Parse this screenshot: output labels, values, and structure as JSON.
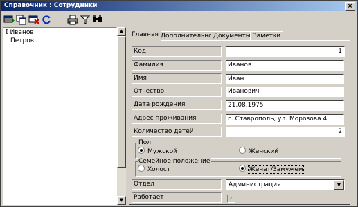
{
  "window": {
    "title": "Справочник : Сотрудники",
    "close_glyph": "×"
  },
  "toolbar": {
    "icons": [
      "add-record-icon",
      "copy-record-icon",
      "delete-record-icon",
      "refresh-icon",
      "print-icon",
      "filter-icon",
      "find-icon"
    ]
  },
  "list": {
    "items": [
      {
        "label": "Иванов",
        "selected": true
      },
      {
        "label": "Петров",
        "selected": false
      }
    ],
    "scroll_up": "▲",
    "scroll_down": "▼"
  },
  "tabs": [
    {
      "label": "Главная",
      "active": true
    },
    {
      "label": "Дополнительно",
      "active": false
    },
    {
      "label": "Документы",
      "active": false
    },
    {
      "label": "Заметки",
      "active": false
    }
  ],
  "fields": {
    "code": {
      "label": "Код",
      "value": "1"
    },
    "surname": {
      "label": "Фамилия",
      "value": "Иванов"
    },
    "name": {
      "label": "Имя",
      "value": "Иван"
    },
    "patronym": {
      "label": "Отчество",
      "value": "Иванович"
    },
    "birthdate": {
      "label": "Дата рождения",
      "value": "21.08.1975"
    },
    "address": {
      "label": "Адрес проживания",
      "value": "г. Ставрополь, ул. Морозова 4"
    },
    "children": {
      "label": "Количество детей",
      "value": "2"
    },
    "department": {
      "label": "Отдел",
      "value": "Администрация",
      "dropdown_glyph": "▼"
    },
    "working": {
      "label": "Работает",
      "checked": true,
      "check_glyph": "✓"
    }
  },
  "gender": {
    "title": "Пол",
    "options": [
      {
        "label": "Мужской",
        "selected": true
      },
      {
        "label": "Женский",
        "selected": false
      }
    ]
  },
  "marital": {
    "title": "Семейное положение",
    "options": [
      {
        "label": "Холост",
        "selected": false
      },
      {
        "label": "Женат/Замужем",
        "selected": true
      }
    ]
  }
}
